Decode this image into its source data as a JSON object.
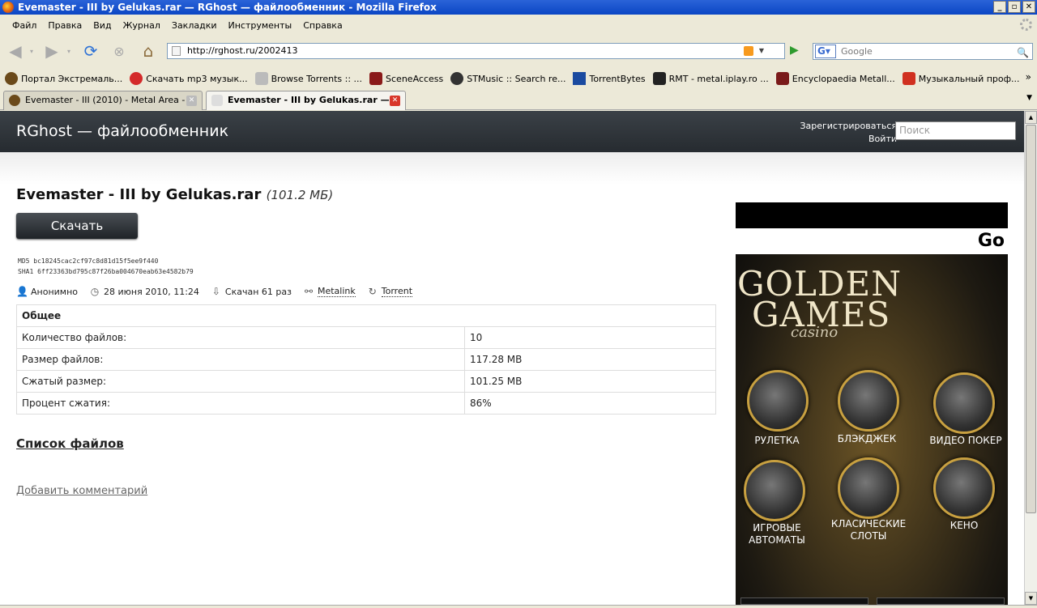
{
  "window": {
    "title": "Evemaster - III by Gelukas.rar — RGhost — файлообменник - Mozilla Firefox"
  },
  "menu": [
    "Файл",
    "Правка",
    "Вид",
    "Журнал",
    "Закладки",
    "Инструменты",
    "Справка"
  ],
  "nav": {
    "url": "http://rghost.ru/2002413",
    "search_placeholder": "Google"
  },
  "bookmarks": [
    {
      "label": "Портал Экстремаль...",
      "icon": "moon-icon",
      "color": "#6b4a1a"
    },
    {
      "label": "Скачать mp3 музык...",
      "icon": "flower-icon",
      "color": "#d42a2a"
    },
    {
      "label": "Browse Torrents :: ...",
      "icon": "page-icon",
      "color": "#9a9a9a"
    },
    {
      "label": "SceneAccess",
      "icon": "scene-icon",
      "color": "#8a1a1a"
    },
    {
      "label": "STMusic :: Search re...",
      "icon": "stmusic-icon",
      "color": "#333333"
    },
    {
      "label": "TorrentBytes",
      "icon": "grid-icon",
      "color": "#1a4aa0"
    },
    {
      "label": "RMT - metal.iplay.ro ...",
      "icon": "guitar-icon",
      "color": "#222222"
    },
    {
      "label": "Encyclopaedia Metall...",
      "icon": "metal-icon",
      "color": "#7a1a1a"
    },
    {
      "label": "Музыкальный проф...",
      "icon": "os-icon",
      "color": "#d03020"
    }
  ],
  "tabs": [
    {
      "label": "Evemaster - III (2010) - Metal Area - ...",
      "active": false
    },
    {
      "label": "Evemaster - III by Gelukas.rar —...",
      "active": true
    }
  ],
  "site": {
    "logo": "RGhost — файлообменник",
    "register": "Зарегистрироваться",
    "login": "Войти",
    "search_placeholder": "Поиск"
  },
  "file": {
    "name": "Evemaster - III by Gelukas.rar",
    "size": "(101.2 МБ)",
    "download_label": "Скачать",
    "md5": "MD5  bc18245cac2cf97c8d81d15f5ee9f440",
    "sha1": "SHA1 6ff23363bd795c87f26ba004670eab63e4582b79",
    "uploader": "Анонимно",
    "date": "28 июня 2010, 11:24",
    "downloads": "Скачан 61 раз",
    "metalink": "Metalink",
    "torrent": "Torrent"
  },
  "info_table": {
    "header": "Общее",
    "rows": [
      [
        "Количество файлов:",
        "10"
      ],
      [
        "Размер файлов:",
        "117.28 MB"
      ],
      [
        "Сжатый размер:",
        "101.25 MB"
      ],
      [
        "Процент сжатия:",
        "86%"
      ]
    ]
  },
  "file_list_label": "Список файлов",
  "add_comment_label": "Добавить комментарий",
  "ad": {
    "strip_text": "Go",
    "brand_line1": "GOLDEN",
    "brand_line2": "GAMES",
    "brand_sub": "casino",
    "games": [
      "РУЛЕТКА",
      "БЛЭКДЖЕК",
      "ВИДЕО ПОКЕР",
      "ИГРОВЫЕ АВТОМАТЫ",
      "КЛАСИЧЕСКИЕ СЛОТЫ",
      "КЕНО"
    ]
  }
}
